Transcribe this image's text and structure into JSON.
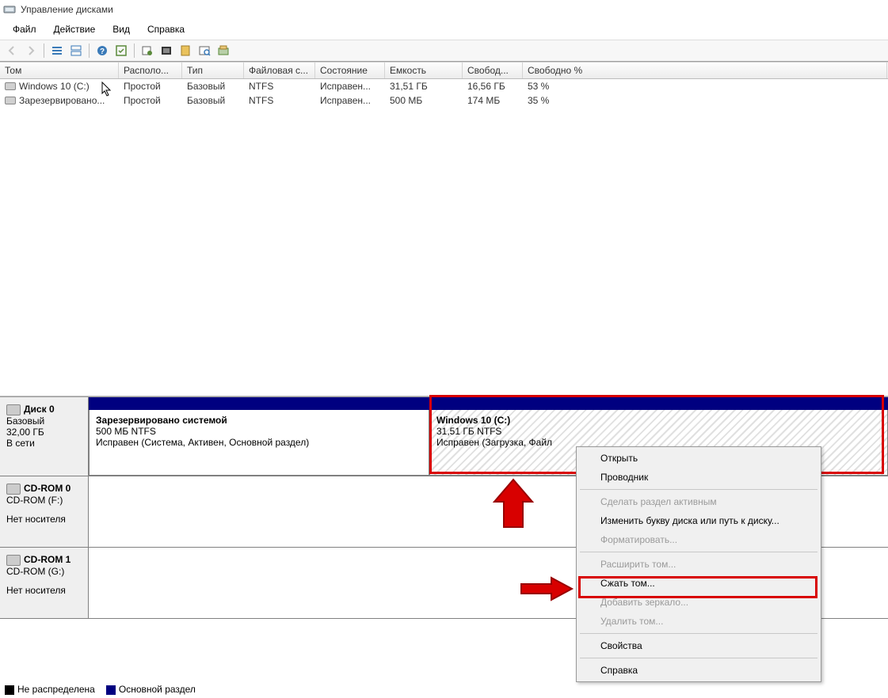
{
  "window": {
    "title": "Управление дисками"
  },
  "menu": {
    "file": "Файл",
    "action": "Действие",
    "view": "Вид",
    "help": "Справка"
  },
  "columns": {
    "volume": "Том",
    "layout": "Располо...",
    "type": "Тип",
    "fs": "Файловая с...",
    "status": "Состояние",
    "capacity": "Емкость",
    "free": "Свобод...",
    "freepct": "Свободно %"
  },
  "volumes": [
    {
      "name": "Windows 10 (C:)",
      "layout": "Простой",
      "type": "Базовый",
      "fs": "NTFS",
      "status": "Исправен...",
      "capacity": "31,51 ГБ",
      "free": "16,56 ГБ",
      "freepct": "53 %"
    },
    {
      "name": "Зарезервировано...",
      "layout": "Простой",
      "type": "Базовый",
      "fs": "NTFS",
      "status": "Исправен...",
      "capacity": "500 МБ",
      "free": "174 МБ",
      "freepct": "35 %"
    }
  ],
  "disks": {
    "disk0": {
      "header": "Диск 0",
      "type": "Базовый",
      "size": "32,00 ГБ",
      "state": "В сети",
      "part1": {
        "title": "Зарезервировано системой",
        "sub": "500 МБ NTFS",
        "status": "Исправен (Система, Активен, Основной раздел)"
      },
      "part2": {
        "title": "Windows 10  (C:)",
        "sub": "31,51 ГБ NTFS",
        "status": "Исправен (Загрузка, Файл"
      }
    },
    "cdrom0": {
      "header": "CD-ROM 0",
      "sub": "CD-ROM (F:)",
      "state": "Нет носителя"
    },
    "cdrom1": {
      "header": "CD-ROM 1",
      "sub": "CD-ROM (G:)",
      "state": "Нет носителя"
    }
  },
  "context": {
    "open": "Открыть",
    "explorer": "Проводник",
    "make_active": "Сделать раздел активным",
    "change_letter": "Изменить букву диска или путь к диску...",
    "format": "Форматировать...",
    "extend": "Расширить том...",
    "shrink": "Сжать том...",
    "mirror": "Добавить зеркало...",
    "delete": "Удалить том...",
    "properties": "Свойства",
    "help": "Справка"
  },
  "legend": {
    "unallocated": "Не распределена",
    "primary": "Основной раздел"
  }
}
